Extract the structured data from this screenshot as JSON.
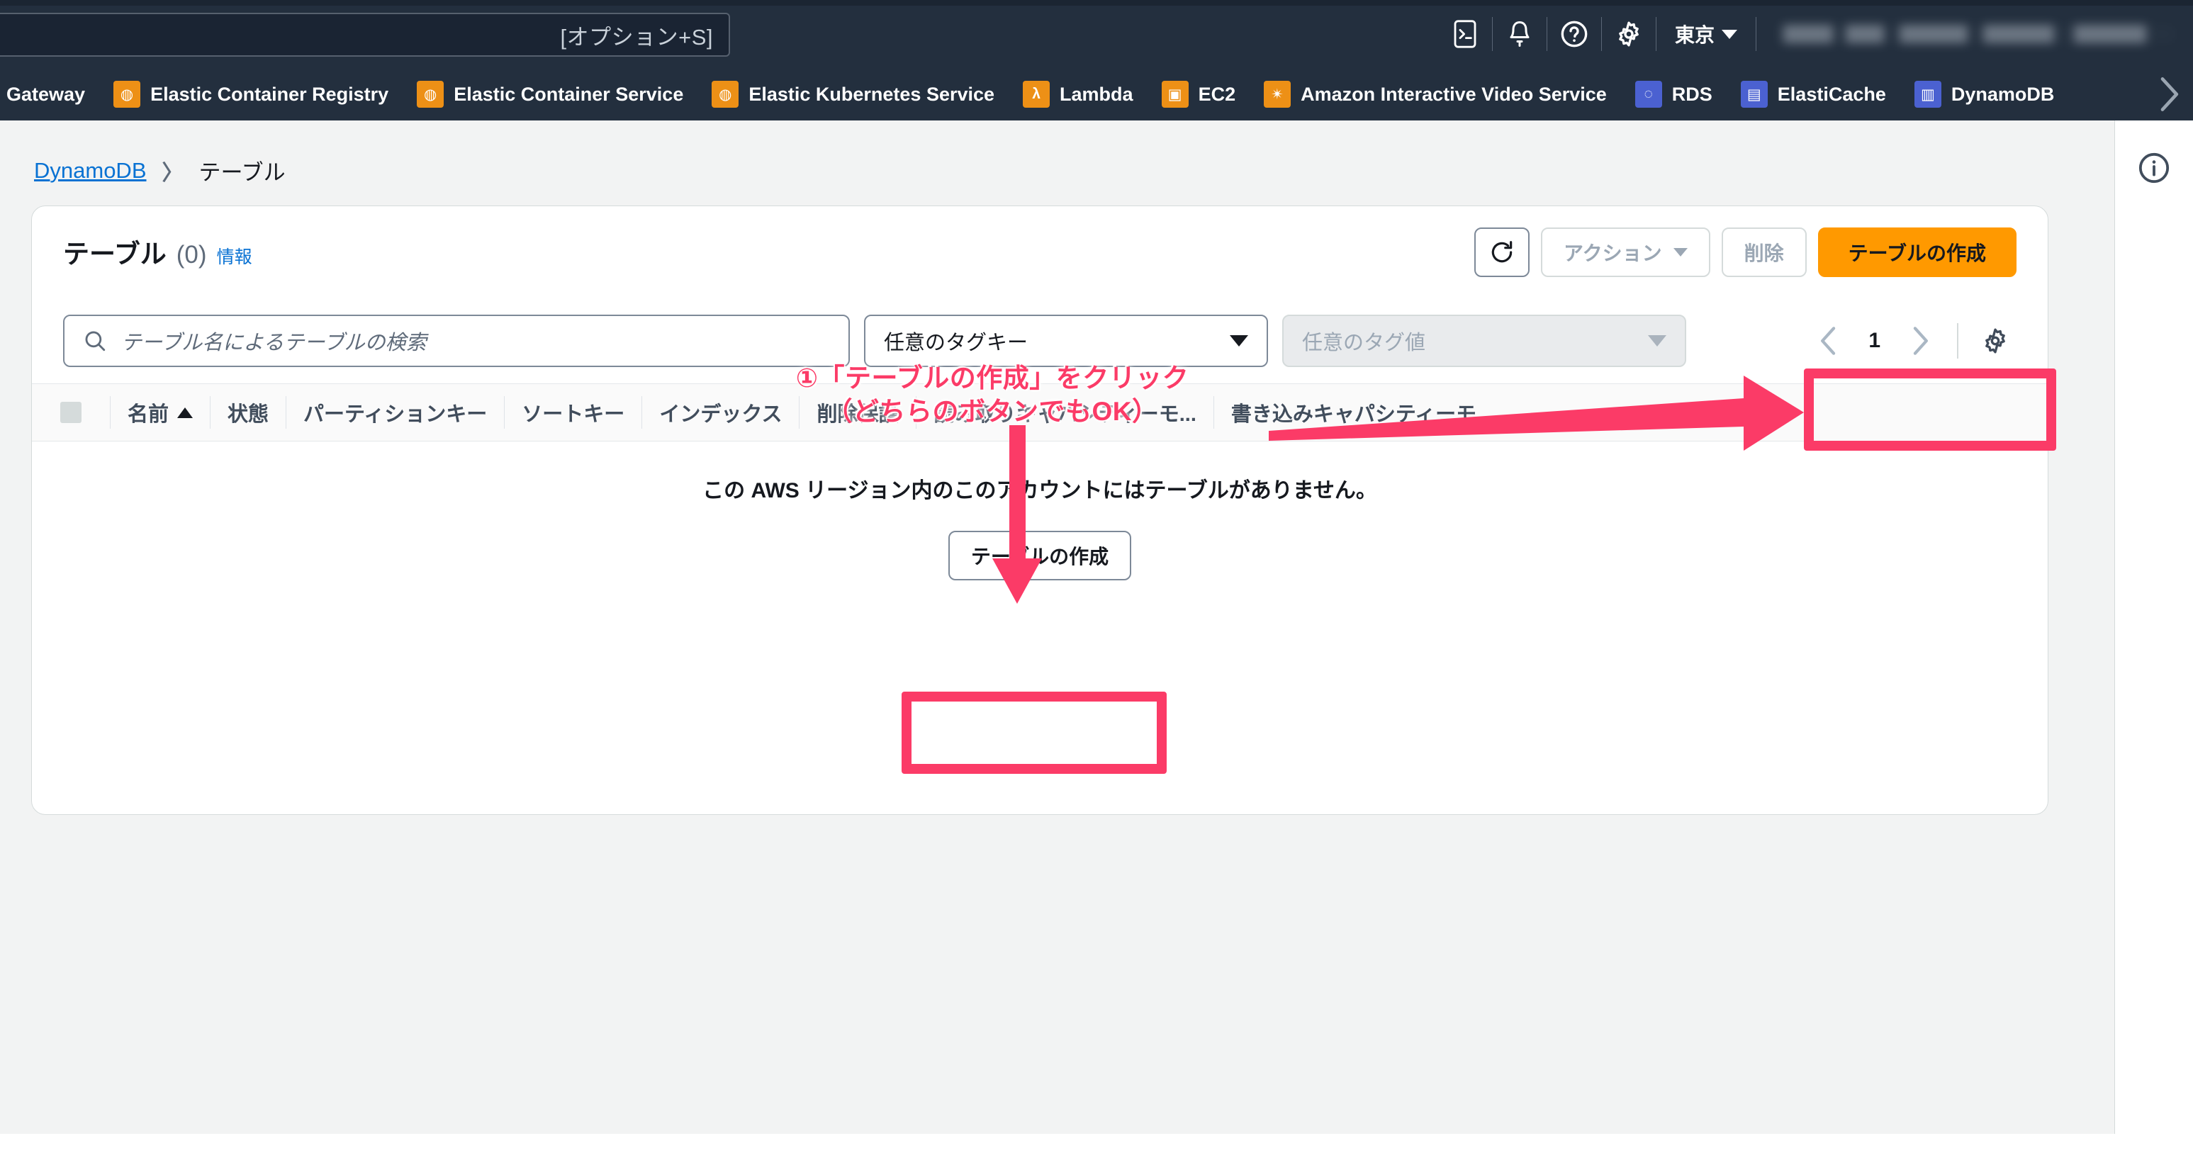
{
  "header": {
    "search_placeholder": "[オプション+S]",
    "region": "東京",
    "icons": {
      "cloudshell": "cloudshell-icon",
      "notifications": "bell-icon",
      "help": "help-icon",
      "settings": "gear-icon"
    },
    "account_label": ""
  },
  "service_nav": {
    "items": [
      {
        "label": "PI Gateway",
        "icon_color": "orange",
        "truncated": true
      },
      {
        "label": "Elastic Container Registry",
        "icon_color": "orange"
      },
      {
        "label": "Elastic Container Service",
        "icon_color": "orange"
      },
      {
        "label": "Elastic Kubernetes Service",
        "icon_color": "orange"
      },
      {
        "label": "Lambda",
        "icon_color": "orange"
      },
      {
        "label": "EC2",
        "icon_color": "orange"
      },
      {
        "label": "Amazon Interactive Video Service",
        "icon_color": "orange"
      },
      {
        "label": "RDS",
        "icon_color": "blue"
      },
      {
        "label": "ElastiCache",
        "icon_color": "blue"
      },
      {
        "label": "DynamoDB",
        "icon_color": "blue"
      }
    ],
    "overflow_chevron": "chevron-right-icon"
  },
  "breadcrumb": {
    "root": "DynamoDB",
    "separator": "〉",
    "current": "テーブル"
  },
  "panel": {
    "title": "テーブル",
    "count": "(0)",
    "info_link": "情報",
    "actions": {
      "refresh": "↻",
      "actions_label": "アクション",
      "secondary_label": "削除",
      "create_label": "テーブルの作成"
    },
    "filters": {
      "search_placeholder": "テーブル名によるテーブルの検索",
      "tag_key": "任意のタグキー",
      "tag_value": "任意のタグ値"
    },
    "pagination": {
      "prev": "‹",
      "page": "1",
      "next": "›",
      "settings_icon": "gear-icon"
    },
    "table": {
      "columns": [
        "名前",
        "状態",
        "パーティションキー",
        "ソートキー",
        "インデックス",
        "削除保護",
        "読み取りキャパシティーモ...",
        "書き込みキャパシティーモ..."
      ],
      "sort_column": "名前",
      "sort_direction": "asc",
      "rows": []
    },
    "empty_state": {
      "message": "この AWS リージョン内のこのアカウントにはテーブルがありません。",
      "create_label": "テーブルの作成"
    }
  },
  "annotation": {
    "line1": "①「テーブルの作成」をクリック",
    "line2": "（どちらのボタンでもOK）",
    "color": "#fb3b67"
  },
  "right_rail": {
    "info_icon": "info-circle-icon"
  },
  "colors": {
    "header_bg": "#232f3e",
    "content_bg": "#f2f3f3",
    "link": "#0972d3",
    "primary_button": "#ff9900",
    "annotation": "#fb3b67"
  }
}
